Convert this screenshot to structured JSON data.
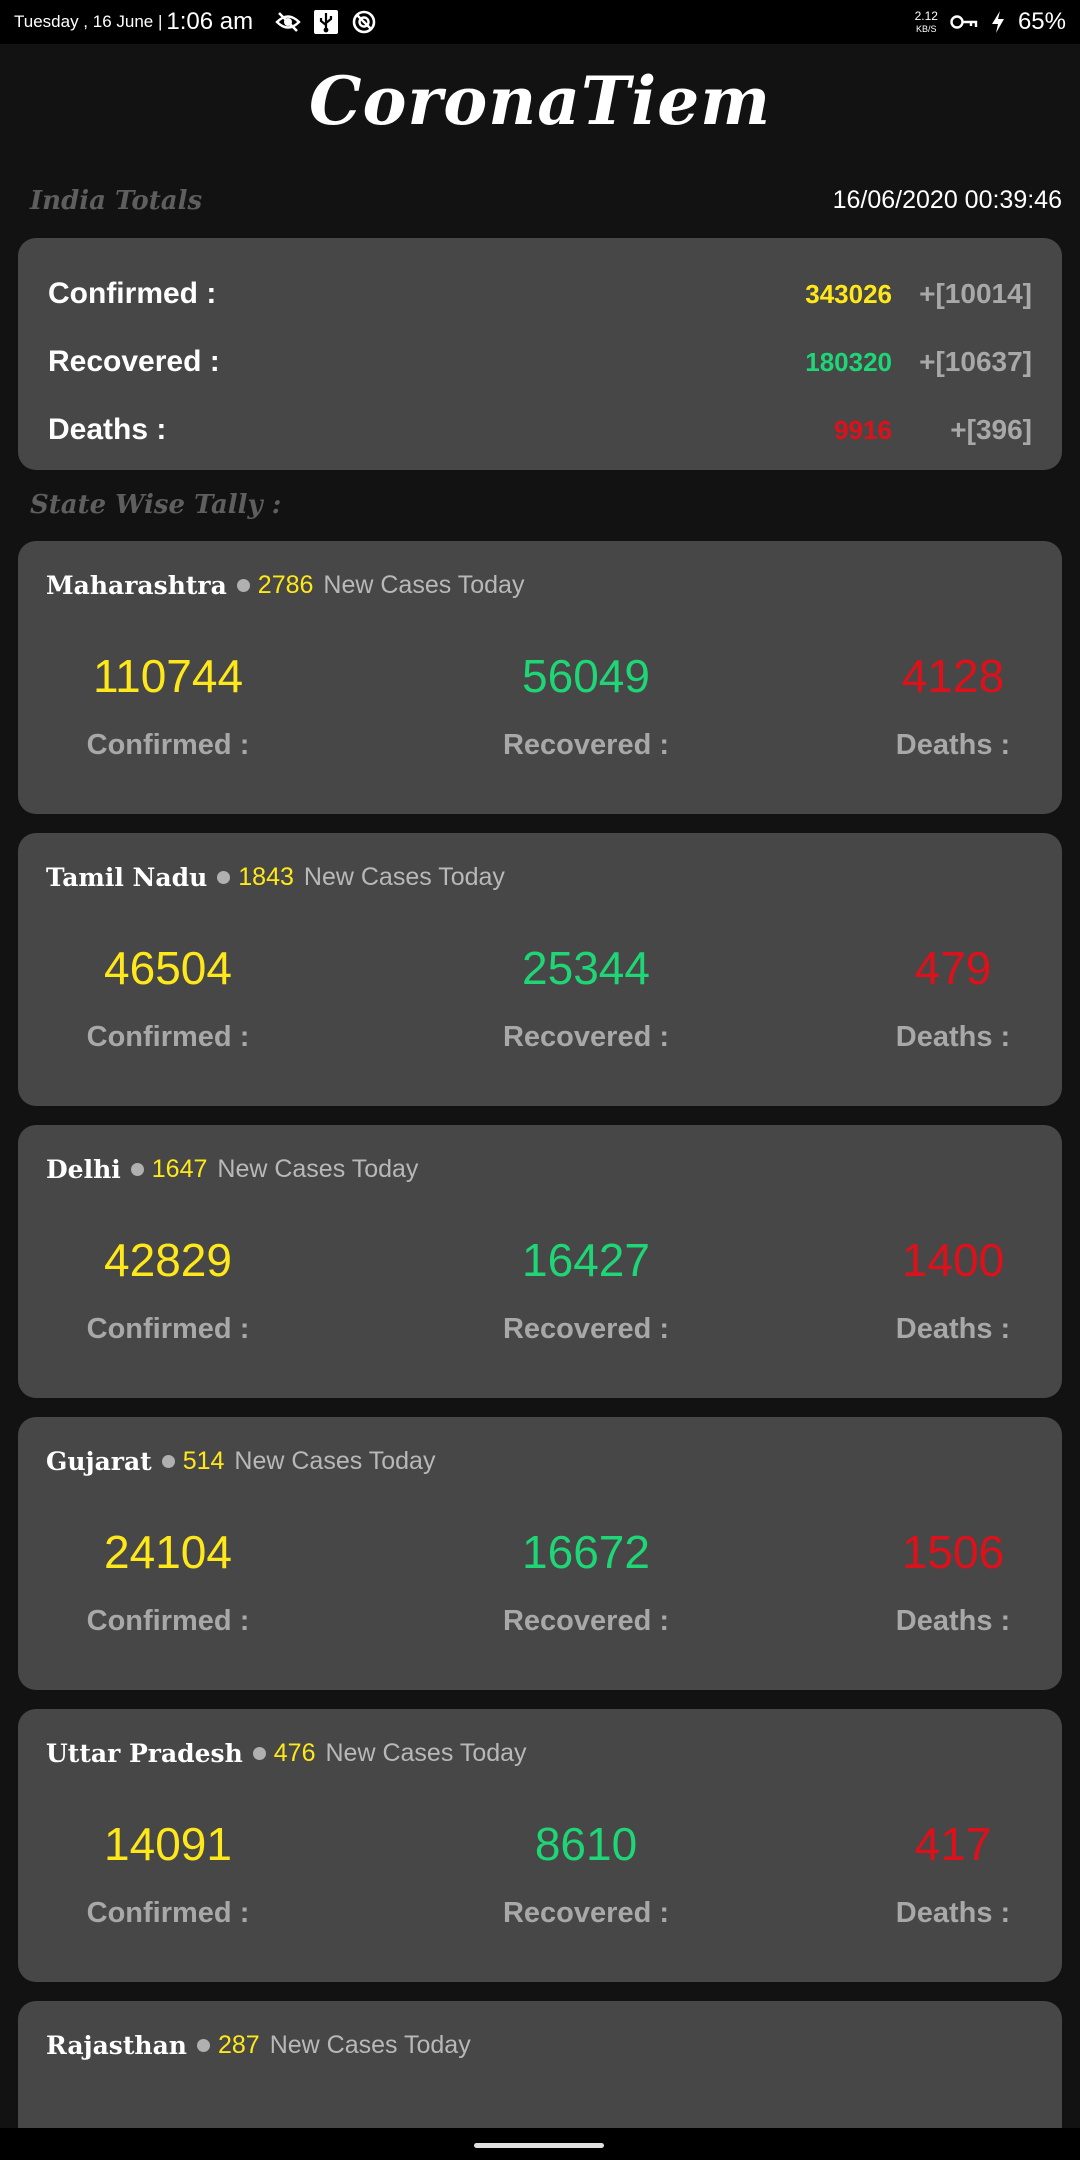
{
  "statusbar": {
    "date": "Tuesday , 16 June |",
    "time": "1:06 am",
    "speed": "2.12",
    "speed_unit": "KB/S",
    "battery": "65%"
  },
  "app_title": "CoronaTiem",
  "india_totals_label": "India Totals",
  "timestamp": "16/06/2020 00:39:46",
  "totals": {
    "confirmed_label": "Confirmed :",
    "confirmed_value": "343026",
    "confirmed_delta": "+[10014]",
    "recovered_label": "Recovered :",
    "recovered_value": "180320",
    "recovered_delta": "+[10637]",
    "deaths_label": "Deaths :",
    "deaths_value": "9916",
    "deaths_delta": "+[396]"
  },
  "state_wise_label": "State Wise Tally :",
  "labels": {
    "new_cases": "New Cases Today",
    "confirmed": "Confirmed :",
    "recovered": "Recovered :",
    "deaths": "Deaths :"
  },
  "states": [
    {
      "name": "Maharashtra",
      "new": "2786",
      "confirmed": "110744",
      "recovered": "56049",
      "deaths": "4128"
    },
    {
      "name": "Tamil Nadu",
      "new": "1843",
      "confirmed": "46504",
      "recovered": "25344",
      "deaths": "479"
    },
    {
      "name": "Delhi",
      "new": "1647",
      "confirmed": "42829",
      "recovered": "16427",
      "deaths": "1400"
    },
    {
      "name": "Gujarat",
      "new": "514",
      "confirmed": "24104",
      "recovered": "16672",
      "deaths": "1506"
    },
    {
      "name": "Uttar Pradesh",
      "new": "476",
      "confirmed": "14091",
      "recovered": "8610",
      "deaths": "417"
    },
    {
      "name": "Rajasthan",
      "new": "287",
      "confirmed": "",
      "recovered": "",
      "deaths": ""
    }
  ],
  "colors": {
    "confirmed": "#ffe81a",
    "recovered": "#1ed676",
    "deaths": "#e0101a",
    "card_bg": "#474747",
    "page_bg": "#121212"
  }
}
